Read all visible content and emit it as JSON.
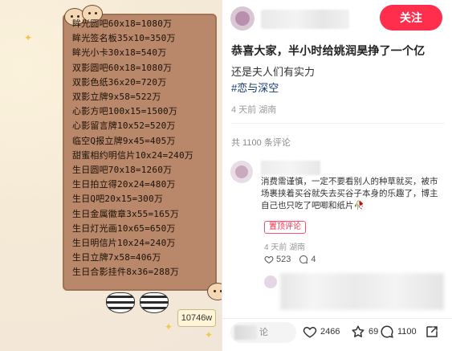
{
  "image": {
    "board_lines": [
      "眸光圆吧60x18=1080万",
      "眸光签名板35x10=350万",
      "眸光小卡30x18=540万",
      "双影圆吧60x18=1080万",
      "双影色纸36x20=720万",
      "双影立牌9x58=522万",
      "心影方吧100x15=1500万",
      "心影留言牌10x52=520万",
      "临空Q报立牌9x45=405万",
      "甜蜜相约明信片10x24=240万",
      "生日圆吧70x18=1260万",
      "生日拍立得20x24=480万",
      "生日Q吧20x15=300万",
      "生日金属徽章3x55=165万",
      "生日灯光画10x65=650万",
      "生日明信片10x24=240万",
      "生日立牌7x58=406万",
      "生日合影挂件8x36=288万"
    ],
    "badge": "10746w"
  },
  "header": {
    "follow_label": "关注"
  },
  "post": {
    "title": "恭喜大家，半小时给姚润昊挣了一个亿",
    "body": "还是夫人们有实力",
    "tag": "#恋与深空",
    "meta": "4 天前  湖南",
    "comment_count": "共 1100 条评论"
  },
  "comment1": {
    "text": "消费需谨慎，一定不要看别人的种草就买，被市场裹挟着买谷就失去买谷子本身的乐趣了，博主自己也只吃了吧唧和纸片🥀",
    "pin_label": "置顶评论",
    "meta": "4 天前  湖南",
    "likes": "523",
    "replies": "4"
  },
  "bottom_bar": {
    "input_placeholder": "论",
    "likes": "2466",
    "favorites": "69",
    "comments": "1100"
  },
  "colors": {
    "accent": "#ff2e4d",
    "tag": "#13386c",
    "board": "#b9876a"
  }
}
